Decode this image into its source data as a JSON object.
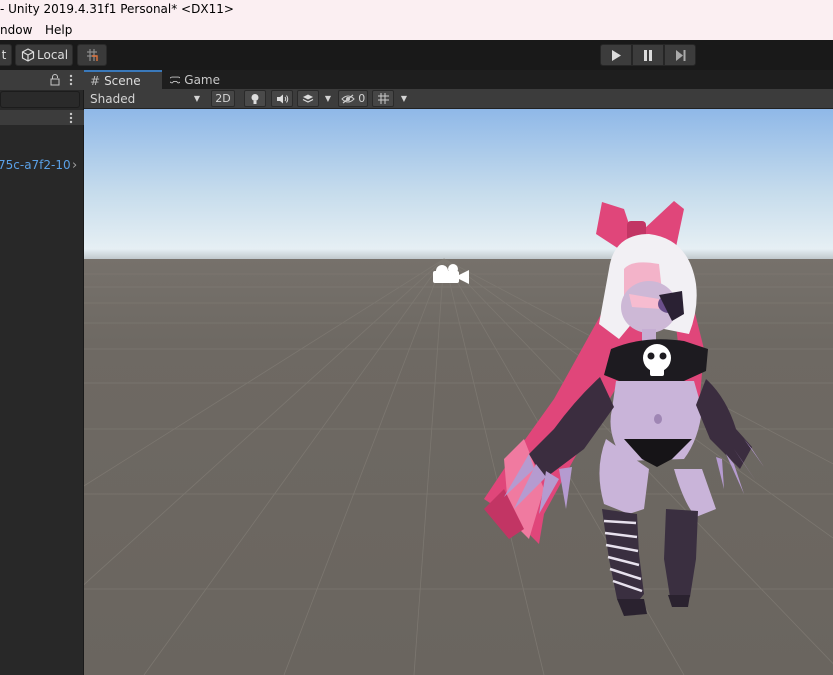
{
  "window": {
    "title": "- Unity 2019.4.31f1 Personal* <DX11>"
  },
  "menu": {
    "items": [
      "ndow",
      "Help"
    ]
  },
  "toolbar": {
    "pivot_label": "t",
    "local_label": "Local",
    "play_icon": "play-icon",
    "pause_icon": "pause-icon",
    "step_icon": "step-icon"
  },
  "hierarchy": {
    "item_label": "75c-a7f2-10"
  },
  "tabs": [
    {
      "label": "Scene",
      "icon": "grid-icon",
      "active": true
    },
    {
      "label": "Game",
      "icon": "gamepad-icon",
      "active": false
    }
  ],
  "scene_toolbar": {
    "shading_mode": "Shaded",
    "mode_2d": "2D",
    "hidden_count": "0"
  },
  "colors": {
    "accent": "#3a79bb",
    "sky_top": "#8fb8e8",
    "horizon": "#e6eff4",
    "ground": "#6b6660",
    "character_pink": "#e0467a"
  }
}
